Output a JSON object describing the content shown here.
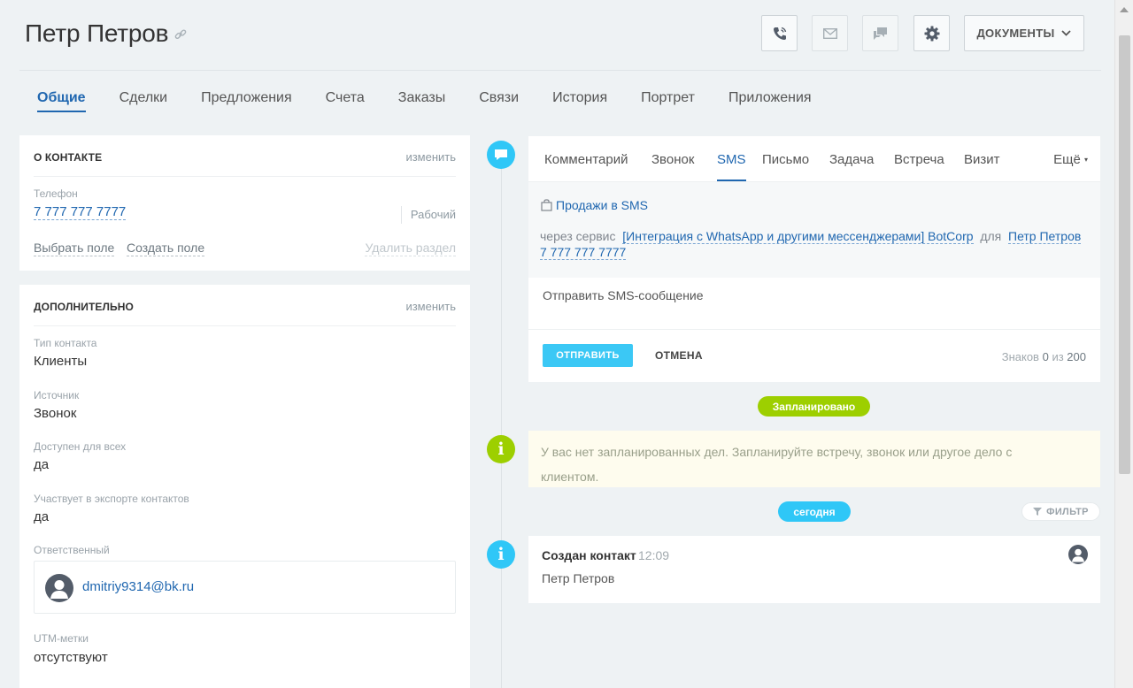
{
  "header": {
    "title": "Петр Петров",
    "documents_label": "ДОКУМЕНТЫ"
  },
  "tabs": [
    {
      "label": "Общие",
      "active": true
    },
    {
      "label": "Сделки"
    },
    {
      "label": "Предложения"
    },
    {
      "label": "Счета"
    },
    {
      "label": "Заказы"
    },
    {
      "label": "Связи"
    },
    {
      "label": "История"
    },
    {
      "label": "Портрет"
    },
    {
      "label": "Приложения"
    }
  ],
  "about": {
    "title": "О КОНТАКТЕ",
    "edit": "изменить",
    "phone_label": "Телефон",
    "phone_value": "7 777 777 7777",
    "phone_type": "Рабочий",
    "choose_field": "Выбрать поле",
    "create_field": "Создать поле",
    "delete_section": "Удалить раздел"
  },
  "extra": {
    "title": "ДОПОЛНИТЕЛЬНО",
    "edit": "изменить",
    "fields": [
      {
        "label": "Тип контакта",
        "value": "Клиенты"
      },
      {
        "label": "Источник",
        "value": "Звонок"
      },
      {
        "label": "Доступен для всех",
        "value": "да"
      },
      {
        "label": "Участвует в экспорте контактов",
        "value": "да"
      }
    ],
    "responsible_label": "Ответственный",
    "responsible_email": "dmitriy9314@bk.ru",
    "utm_label": "UTM-метки",
    "utm_value": "отсутствуют"
  },
  "editor": {
    "tabs": [
      "Комментарий",
      "Звонок",
      "SMS",
      "Письмо",
      "Задача",
      "Встреча",
      "Визит"
    ],
    "active_tab": "SMS",
    "more": "Ещё",
    "provider": "Продажи в SMS",
    "via_prefix": "через сервис",
    "via_service": "[Интеграция с WhatsApp и другими мессенджерами] BotCorp",
    "via_for": "для",
    "via_contact": "Петр Петров",
    "via_phone": "7 777 777 7777",
    "placeholder": "Отправить SMS-сообщение",
    "send": "ОТПРАВИТЬ",
    "cancel": "ОТМЕНА",
    "counter_prefix": "Знаков",
    "counter_value": "0",
    "counter_mid": "из",
    "counter_max": "200"
  },
  "timeline": {
    "planned": "Запланировано",
    "planned_notice": "У вас нет запланированных дел. Запланируйте встречу, звонок или другое дело с клиентом.",
    "today": "сегодня",
    "filter": "ФИЛЬТР",
    "event_title": "Создан контакт",
    "event_time": "12:09",
    "event_text": "Петр Петров"
  },
  "colors": {
    "accent": "#2067b0",
    "timeline_blue": "#2fc7f7",
    "timeline_green": "#9dcf00",
    "send_button": "#3bc8f5"
  }
}
